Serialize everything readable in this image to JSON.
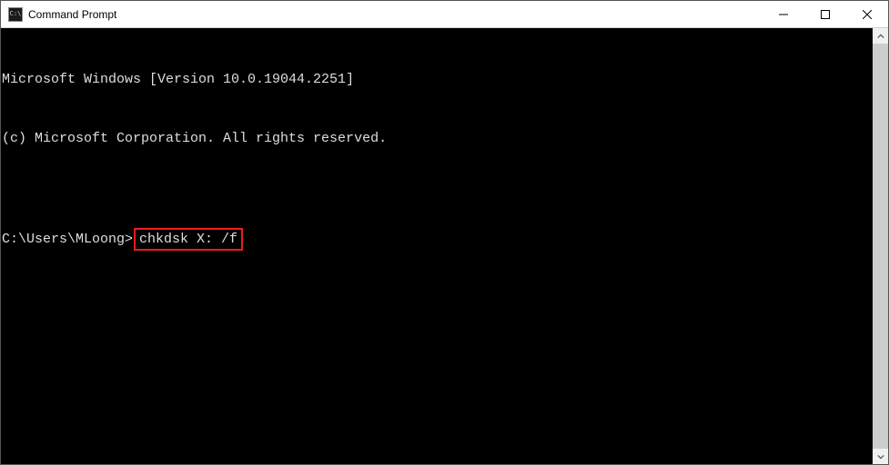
{
  "titlebar": {
    "title": "Command Prompt",
    "icon_label": "C:\\"
  },
  "terminal": {
    "line1": "Microsoft Windows [Version 10.0.19044.2251]",
    "line2": "(c) Microsoft Corporation. All rights reserved.",
    "blank": "",
    "prompt": "C:\\Users\\MLoong>",
    "command": "chkdsk X: /f"
  }
}
